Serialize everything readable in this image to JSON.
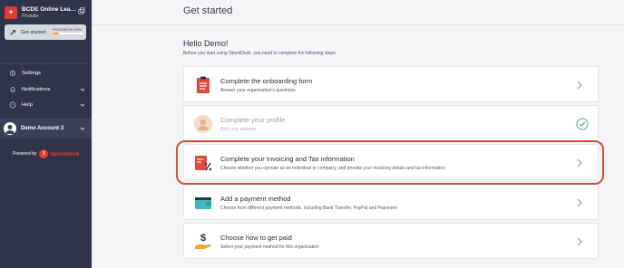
{
  "sidebar": {
    "org_name": "BCDE Online Lear...",
    "org_role": "Provider",
    "get_started": {
      "label": "Get started",
      "progress_label": "PROGRESS 20%",
      "progress": 0.2
    },
    "nav": [
      {
        "label": "Settings",
        "icon": "gear-icon"
      },
      {
        "label": "Notifications",
        "icon": "bell-icon"
      },
      {
        "label": "Help",
        "icon": "question-circle-icon"
      }
    ],
    "account_name": "Demo Account 3",
    "powered_by": "Powered by",
    "brand_name": "talentdesk"
  },
  "main": {
    "title": "Get started",
    "greeting": "Hello Demo!",
    "intro": "Before you start using TalentDesk, you need to complete the following steps:",
    "steps": [
      {
        "title": "Complete the onboarding form",
        "description": "Answer your organisation's questions",
        "icon": "clipboard-form-icon",
        "status": "pending"
      },
      {
        "title": "Complete your profile",
        "description": "Add your address",
        "icon": "user-profile-icon",
        "status": "done"
      },
      {
        "title": "Complete your Invoicing and Tax information",
        "description": "Choose whether you operate as an individual or company, and provide your invoicing details and tax information",
        "icon": "tax-document-icon",
        "status": "pending"
      },
      {
        "title": "Add a payment method",
        "description": "Choose from different payment methods, including Bank Transfer, PayPal and Payoneer",
        "icon": "wallet-icon",
        "status": "pending"
      },
      {
        "title": "Choose how to get paid",
        "description": "Select your payment method for this organization",
        "icon": "hand-dollar-icon",
        "status": "pending"
      }
    ]
  },
  "colors": {
    "sidebar_bg": "#2f3448",
    "accent": "#e63b2e",
    "progress_fill": "#f6a623",
    "highlight": "#d94b3f",
    "check": "#4caf7a"
  }
}
